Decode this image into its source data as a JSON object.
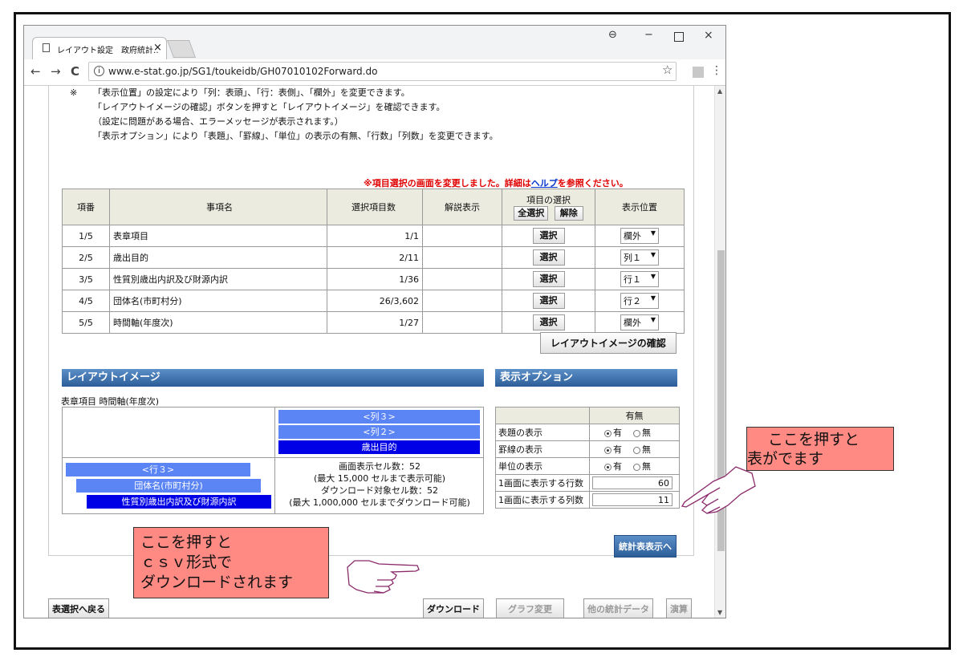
{
  "browser": {
    "tab_title": "レイアウト設定　政府統計‥",
    "tab_close": "×",
    "url": "www.e-stat.go.jp/SG1/toukeidb/GH07010102Forward.do",
    "back": "←",
    "forward": "→",
    "reload": "C",
    "star": "☆",
    "menu": "⋮",
    "user_icon": "⊖",
    "minimize": "−",
    "close": "×"
  },
  "notes": {
    "mark": "※",
    "lines": [
      "「表示位置」の設定により「列：表頭」、「行：表側」、「欄外」を変更できます。",
      "「レイアウトイメージの確認」ボタンを押すと「レイアウトイメージ」を確認できます。",
      "（設定に問題がある場合、エラーメッセージが表示されます。）",
      "「表示オプション」により「表題」、「罫線」、「単位」の表示の有無、「行数」「列数」を変更できます。"
    ]
  },
  "red_message": {
    "prefix": "※項目選択の画面を変更しました。詳細は",
    "link": "ヘルプ",
    "suffix": "を参照ください。"
  },
  "items_table": {
    "headers": {
      "num": "項番",
      "name": "事項名",
      "count": "選択項目数",
      "desc": "解説表示",
      "select": "項目の選択",
      "position": "表示位置"
    },
    "select_all": "全選択",
    "clear": "解除",
    "select_btn": "選択",
    "rows": [
      {
        "num": "1/5",
        "name": "表章項目",
        "count": "1/1",
        "position": "欄外"
      },
      {
        "num": "2/5",
        "name": "歳出目的",
        "count": "2/11",
        "position": "列１"
      },
      {
        "num": "3/5",
        "name": "性質別歳出内訳及び財源内訳",
        "count": "1/36",
        "position": "行１"
      },
      {
        "num": "4/5",
        "name": "団体名(市町村分)",
        "count": "26/3,602",
        "position": "行２"
      },
      {
        "num": "5/5",
        "name": "時間軸(年度次)",
        "count": "1/27",
        "position": "欄外"
      }
    ]
  },
  "layout_confirm_btn": "レイアウトイメージの確認",
  "layout_section": {
    "title": "レイアウトイメージ",
    "caption": "表章項目 時間軸(年度次)",
    "col3": "<列３>",
    "col2": "<列２>",
    "col1": "歳出目的",
    "row3": "<行３>",
    "row2": "団体名(市町村分)",
    "row1": "性質別歳出内訳及び財源内訳",
    "info": [
      "画面表示セル数：52",
      "(最大 15,000 セルまで表示可能)",
      "ダウンロード対象セル数：52",
      "(最大 1,000,000 セルまでダウンロード可能)"
    ]
  },
  "options_section": {
    "title": "表示オプション",
    "header": "有無",
    "rows": [
      {
        "label": "表題の表示",
        "yes": "有",
        "no": "無"
      },
      {
        "label": "罫線の表示",
        "yes": "有",
        "no": "無"
      },
      {
        "label": "単位の表示",
        "yes": "有",
        "no": "無"
      }
    ],
    "rows_label": "1画面に表示する行数",
    "rows_value": "60",
    "cols_label": "1画面に表示する列数",
    "cols_value": "11"
  },
  "stat_table_btn": "統計表表示へ",
  "bottom_buttons": {
    "back": "表選択へ戻る",
    "download": "ダウンロード",
    "graph": "グラフ変更",
    "other": "他の統計データ",
    "calc": "演算"
  },
  "callouts": {
    "right": [
      "ここを押すと",
      "表がでます"
    ],
    "left": [
      "ここを押すと",
      "ｃｓｖ形式で",
      "ダウンロードされます"
    ]
  },
  "colors": {
    "section_bar": "#2c5d98",
    "light_blue_bar": "#5b84f5",
    "dark_blue_bar": "#0000e6",
    "callout": "#ff8a84",
    "red_message": "#e00000"
  }
}
